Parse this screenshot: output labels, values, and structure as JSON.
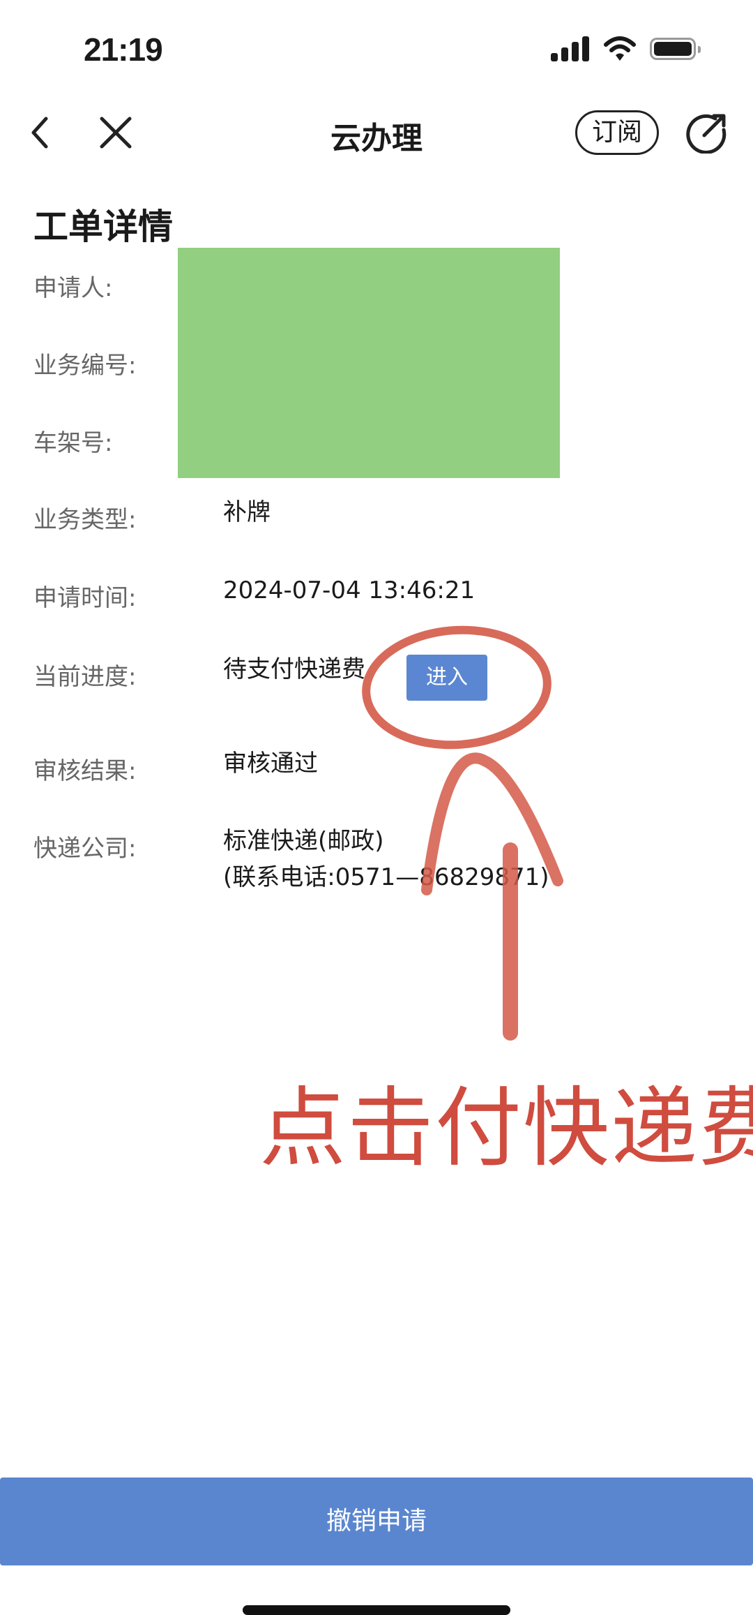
{
  "status_bar": {
    "time": "21:19"
  },
  "nav": {
    "title": "云办理",
    "subscribe_label": "订阅",
    "icons": [
      "back-icon",
      "close-icon",
      "share-icon"
    ]
  },
  "page_title": "工单详情",
  "fields": [
    {
      "label": "申请人:",
      "value": ""
    },
    {
      "label": "业务编号:",
      "value": ""
    },
    {
      "label": "车架号:",
      "value": ""
    },
    {
      "label": "业务类型:",
      "value": "补牌"
    },
    {
      "label": "申请时间:",
      "value": "2024-07-04 13:46:21"
    },
    {
      "label": "当前进度:",
      "value": "待支付快递费"
    },
    {
      "label": "审核结果:",
      "value": "审核通过"
    },
    {
      "label": "快递公司:",
      "value": "标准快递(邮政)",
      "value2": "(联系电话:0571—86829871)"
    }
  ],
  "enter_button_label": "进入",
  "annotation_text": "点击付快递费",
  "cancel_button_label": "撤销申请",
  "colors": {
    "accent": "#5a86cf",
    "annotation": "#cf4c3f",
    "redaction": "#92cf80"
  }
}
